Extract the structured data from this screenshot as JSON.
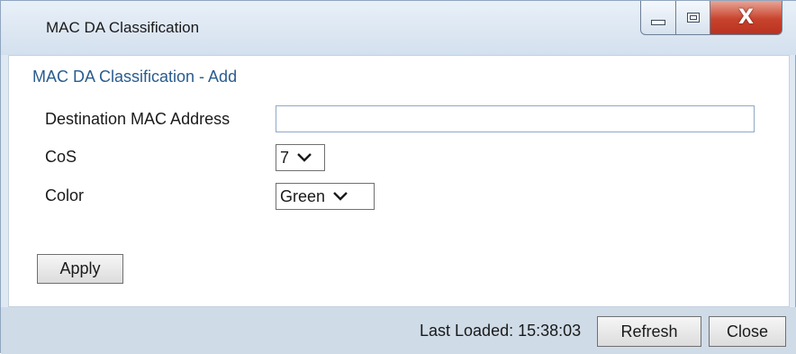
{
  "window": {
    "title": "MAC DA Classification",
    "controls": {
      "minimize": "minimize-icon",
      "maximize": "maximize-icon",
      "close_glyph": "X"
    }
  },
  "form": {
    "section_title": "MAC DA Classification - Add",
    "fields": {
      "dest_mac_label": "Destination MAC Address",
      "dest_mac_value": "",
      "cos_label": "CoS",
      "cos_value": "7",
      "color_label": "Color",
      "color_value": "Green"
    },
    "apply_label": "Apply"
  },
  "footer": {
    "last_loaded": "Last Loaded: 15:38:03",
    "refresh_label": "Refresh",
    "close_label": "Close"
  },
  "colors": {
    "section_title": "#2a5c8f",
    "close_button": "#c8432d",
    "footer_bg": "#cfdbe7"
  }
}
